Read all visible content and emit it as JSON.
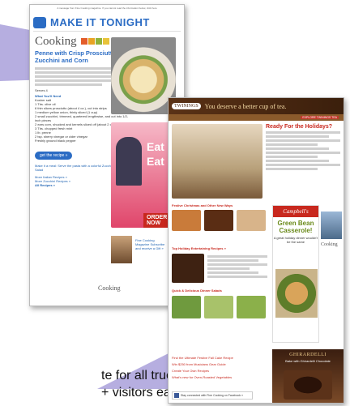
{
  "email1": {
    "preheader": "A message from Fine Cooking magazine. If you cannot read the information below, click here",
    "banner": "MAKE IT TONIGHT",
    "brand": "Cooking",
    "recipe_title": "Penne with Crisp Prosciutto, Zucchini and Corn",
    "serves": "Serves 4",
    "need_label": "What You'll Need",
    "ingredients": [
      "Kosher salt",
      "1 Tbs. olive oil",
      "6 thin slices prosciutto (about 4 oz.), cut into strips",
      "1 medium yellow onion, thinly sliced (1 cup)",
      "2 small zucchini, trimmed, quartered lengthwise, and cut into 1/2-inch pieces",
      "2 ears corn, shucked and kernels sliced off (about 2 cups)",
      "3 Tbs. chopped fresh mint",
      "1 lb. penne",
      "2 tsp. sherry vinegar or cider vinegar",
      "Freshly ground black pepper"
    ],
    "get_recipe": "get the recipe »",
    "meal_note": "Make it a meal: Serve the pasta with a colorful Zucchini Ribbon Salad",
    "more_links": [
      "More Italian Recipes »",
      "More Zucchini Recipes »",
      "All Recipes »"
    ],
    "ad_words": [
      "Eat",
      "Eat",
      "ORDER NOW"
    ],
    "promo": "Fine Cooking Magazine Subscribe and receive a Gift »",
    "footer_brand": "Cooking"
  },
  "email2": {
    "header_brand": "TWININGS",
    "header_tagline": "You deserve a better cup of tea.",
    "header_button": "EXPLORE TWININGS TEA",
    "title": "Ready For the Holidays?",
    "sections": [
      "Festive Christmas and Other New Ways",
      "Top Holiday Entertaining Recipes »",
      "Quick & Delicious Dinner Salads"
    ],
    "links": [
      "Find the Ultimate Festive Fall Cake Recipe",
      "Win $250 from Musicians Gear Guide",
      "Create Your Own Recipes",
      "What's new for Oven-Roasted Vegetables"
    ],
    "campbells": "Campbell's",
    "casserole_title": "Green Bean Casserole!",
    "casserole_sub": "A great holiday dinner wouldn't be the same",
    "ghirardelli": "GHIRARDELLI",
    "ghirardelli_sub": "Bake with Ghirardelli Chocolate",
    "facebook": "Stay connected with Fine Cooking on Facebook »",
    "brand": "Cooking"
  },
  "caption": {
    "line1": "te for all true food",
    "line2": "+ visitors each"
  },
  "colors": {
    "accent": "#b6aee0",
    "blue": "#2b6cc4",
    "red": "#c8281e",
    "tea_dark": "#4e2a14"
  }
}
